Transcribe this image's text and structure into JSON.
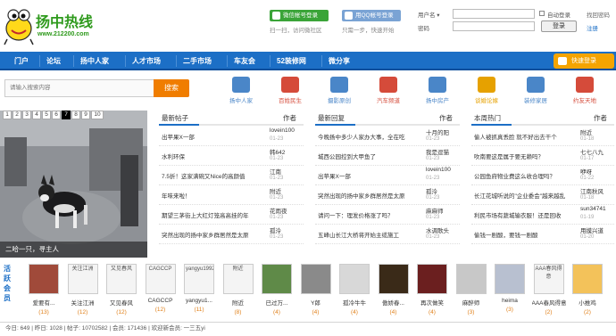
{
  "header": {
    "site_domain": "www.212200.com",
    "wechat_login": "微信帐号登录",
    "wechat_hint": "扫一扫，访问微社区",
    "qq_login": "用QQ帐号登录",
    "qq_hint": "只需一步，快速开始",
    "username_label": "用户名",
    "password_label": "密码",
    "auto_login": "自动登录",
    "login_button": "登录",
    "forgot_password": "找回密码",
    "register": "注册"
  },
  "nav": {
    "items": [
      "门户",
      "论坛",
      "扬中人家",
      "人才市场",
      "二手市场",
      "车友会",
      "52装修网",
      "微分享"
    ],
    "app_button": "快速登录"
  },
  "search": {
    "placeholder": "请输入搜索内容",
    "button": "搜索"
  },
  "quick_links": [
    {
      "label": "扬中人家",
      "color": "#4a86c8"
    },
    {
      "label": "百姓民生",
      "color": "#d54b3a"
    },
    {
      "label": "摄影原创",
      "color": "#4a86c8"
    },
    {
      "label": "汽车频道",
      "color": "#d54b3a"
    },
    {
      "label": "扬中房产",
      "color": "#4a86c8"
    },
    {
      "label": "谈婚论嫁",
      "color": "#e6a100"
    },
    {
      "label": "装修家居",
      "color": "#4a86c8"
    },
    {
      "label": "约友天地",
      "color": "#d54b3a"
    }
  ],
  "slideshow": {
    "pages": [
      "1",
      "2",
      "3",
      "4",
      "5",
      "6",
      "7",
      "8",
      "9",
      "10"
    ],
    "active_page": 7,
    "caption": "二哈一只，寻主人"
  },
  "columns": [
    {
      "title": "最新帖子",
      "author_header": "作者",
      "rows": [
        {
          "title": "出苹果X一部",
          "author": "lovein100",
          "date": "01-23"
        },
        {
          "title": "水利环保",
          "author": "韩642",
          "date": "01-23"
        },
        {
          "title": "7.5折！这家满碗又Nice的高颜值",
          "author": "江南",
          "date": "01-23"
        },
        {
          "title": "年味来啦！",
          "author": "附近",
          "date": "01-23"
        },
        {
          "title": "期望三茅街上大红灯笼高高挂的年",
          "author": "花雨夜",
          "date": "01-23"
        },
        {
          "title": "突然出现的扬中家乡群居然是太原",
          "author": "孤泠",
          "date": "01-23"
        }
      ]
    },
    {
      "title": "最新回复",
      "author_header": "作者",
      "rows": [
        {
          "title": "今晚扬中多少人家办大事，全在吃",
          "author": "十月的阳",
          "date": "01-23"
        },
        {
          "title": "城西公园控到大甲鱼了",
          "author": "我是逗猫",
          "date": "01-23"
        },
        {
          "title": "出苹果X一部",
          "author": "lovein100",
          "date": "01-23"
        },
        {
          "title": "突然出现的扬中家乡群居然是太原",
          "author": "孤泠",
          "date": "01-23"
        },
        {
          "title": "请问一下：理发价格涨了吗？",
          "author": "麻麻师",
          "date": "01-23"
        },
        {
          "title": "五峰山长江大桥将开始主缆施工",
          "author": "水调歌头",
          "date": "01-23"
        }
      ]
    },
    {
      "title": "本周热门",
      "author_header": "作者",
      "rows": [
        {
          "title": "偷人被抓真丢脸 就不好出去干个",
          "author": "附近",
          "date": "01-18"
        },
        {
          "title": "吹南要这是属于要无赖吗？",
          "author": "七七八九",
          "date": "01-17"
        },
        {
          "title": "公园鱼府物业费这么收合理吗？",
          "author": "咿呀",
          "date": "01-22"
        },
        {
          "title": "长江花城听说的\"企业委会\"越来越乱",
          "author": "江南秋风",
          "date": "01-18"
        },
        {
          "title": "利民市场有蔬城输衣服！还是回收",
          "author": "sun34741",
          "date": "01-19"
        },
        {
          "title": "偷钱一剧酸，要钱一剧酸",
          "author": "用摸兴道",
          "date": "01-20"
        }
      ]
    }
  ],
  "members": {
    "label": "活跃会员",
    "items": [
      {
        "name": "爱要有...",
        "count": "(13)",
        "photo_alt": "",
        "photo_color": "#a04a3a"
      },
      {
        "name": "关注江洲",
        "count": "(12)",
        "photo_alt": "关注江洲",
        "photo_color": ""
      },
      {
        "name": "又见春风",
        "count": "(12)",
        "photo_alt": "又见春风",
        "photo_color": ""
      },
      {
        "name": "CAGCCP",
        "count": "(12)",
        "photo_alt": "CAGCCP",
        "photo_color": ""
      },
      {
        "name": "yangyu1...",
        "count": "(11)",
        "photo_alt": "yangyu19921012",
        "photo_color": ""
      },
      {
        "name": "附近",
        "count": "(8)",
        "photo_alt": "附近",
        "photo_color": ""
      },
      {
        "name": "已过万...",
        "count": "(4)",
        "photo_alt": "",
        "photo_color": "#5f8a48"
      },
      {
        "name": "Y郎",
        "count": "(4)",
        "photo_alt": "",
        "photo_color": "#8a8a8a"
      },
      {
        "name": "孤冷牛牛",
        "count": "(4)",
        "photo_alt": "",
        "photo_color": "#d8d8d8"
      },
      {
        "name": "傲娇春...",
        "count": "(4)",
        "photo_alt": "",
        "photo_color": "#3a2a18"
      },
      {
        "name": "再次做笑",
        "count": "(4)",
        "photo_alt": "",
        "photo_color": "#6b1f1f"
      },
      {
        "name": "麻醉师",
        "count": "(3)",
        "photo_alt": "",
        "photo_color": "#c8c8c8"
      },
      {
        "name": "heima",
        "count": "(3)",
        "photo_alt": "",
        "photo_color": "#b8c0d0"
      },
      {
        "name": "AAA春风得意",
        "count": "(2)",
        "photo_alt": "AAA春风得意",
        "photo_color": ""
      },
      {
        "name": "小推鸡",
        "count": "(2)",
        "photo_alt": "",
        "photo_color": "#f3c25a"
      }
    ]
  },
  "footer": {
    "text": "今日: 649 | 昨日: 1028 | 帖子: 10702582 | 会员: 171436 | 欢迎新会员: 一三五yi"
  }
}
